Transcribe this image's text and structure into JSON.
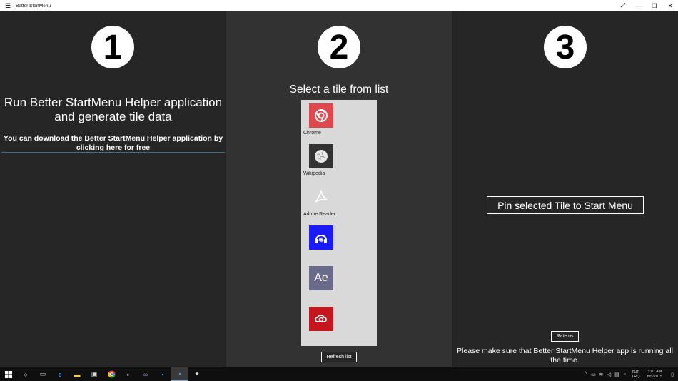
{
  "window": {
    "title": "Better StartMenu",
    "menu_icon": "hamburger-icon",
    "controls": {
      "fullscreen_icon": "expand-icon",
      "minimize_icon": "minimize-icon",
      "restore_icon": "restore-icon",
      "close_icon": "close-icon"
    }
  },
  "step1": {
    "number": "1",
    "heading_line1": "Run Better StartMenu Helper application",
    "heading_line2": "and generate tile data",
    "download_line1": "You can download the Better StartMenu Helper application by",
    "download_line2": "clicking here for free"
  },
  "step2": {
    "number": "2",
    "heading": "Select a tile from list",
    "tiles": [
      {
        "label": "Chrome",
        "icon": "chrome-icon",
        "color": "#e0474c"
      },
      {
        "label": "Wikipedia",
        "icon": "wikipedia-icon",
        "color": "#333333"
      },
      {
        "label": "Adobe Reader",
        "icon": "adobe-reader-icon",
        "color": "#d9d9d9"
      },
      {
        "label": "",
        "icon": "headphones-icon",
        "color": "#1a1aff"
      },
      {
        "label": "",
        "icon": "after-effects-icon",
        "color": "#6a6a8a",
        "glyph": "Ae"
      },
      {
        "label": "",
        "icon": "creative-cloud-icon",
        "color": "#c4161c"
      }
    ],
    "refresh_label": "Refresh list"
  },
  "step3": {
    "number": "3",
    "pin_label": "Pin selected Tile to Start Menu",
    "rate_label": "Rate us",
    "note_line1": "Please make sure that Better StartMenu Helper app is running all",
    "note_line2": "the time."
  },
  "taskbar": {
    "items": [
      "windows-start-icon",
      "cortana-icon",
      "task-view-icon",
      "edge-icon",
      "file-explorer-icon",
      "store-icon",
      "chrome-icon",
      "app-icon",
      "visual-studio-icon",
      "app-window-icon",
      "better-startmenu-icon",
      "app-bird-icon"
    ],
    "lang_line1": "TUR",
    "lang_line2": "TRQ",
    "time": "3:07 AM",
    "date": "8/5/2015"
  }
}
